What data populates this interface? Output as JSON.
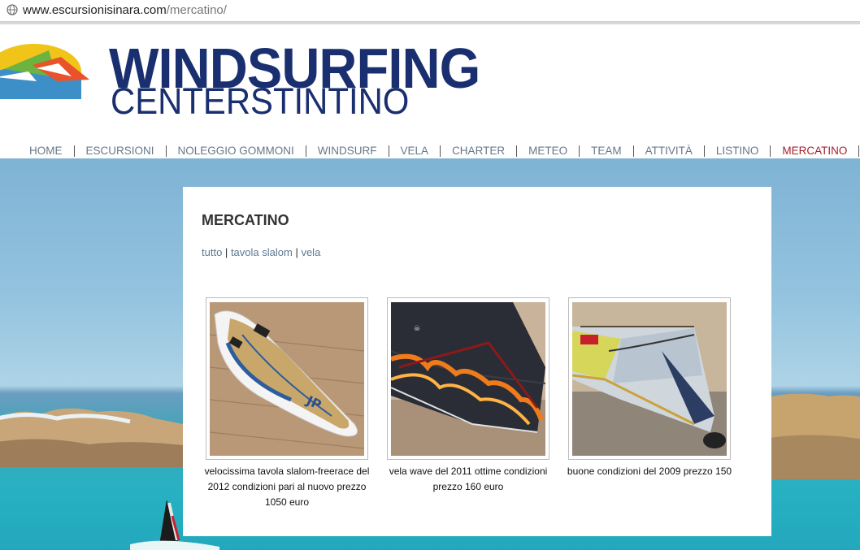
{
  "browser": {
    "url_domain": "www.escursionisinara.com",
    "url_path": "/mercatino/"
  },
  "header": {
    "brand_line1": "WINDSURFING",
    "brand_line2": "CENTERSTINTINO"
  },
  "nav": {
    "items": [
      "HOME",
      "ESCURSIONI",
      "NOLEGGIO GOMMONI",
      "WINDSURF",
      "VELA",
      "CHARTER",
      "METEO",
      "TEAM",
      "ATTIVITÀ",
      "LISTINO",
      "MERCATINO"
    ],
    "active": "MERCATINO"
  },
  "main": {
    "title": "MERCATINO",
    "filters": [
      "tutto",
      "tavola slalom",
      "vela"
    ],
    "filter_separator": "|",
    "products": [
      {
        "caption": "velocissima tavola slalom-freerace del 2012 condizioni pari al nuovo prezzo 1050 euro",
        "image": "windsurf-board"
      },
      {
        "caption": "vela wave del 2011 ottime condizioni prezzo 160 euro",
        "image": "wave-sail-flames"
      },
      {
        "caption": "buone condizioni del 2009 prezzo 150",
        "image": "sail-yellow-blue"
      }
    ]
  },
  "colors": {
    "brand": "#1a2f70",
    "nav_text": "#66788a",
    "nav_active": "#a6202d",
    "link": "#5c7a93"
  }
}
